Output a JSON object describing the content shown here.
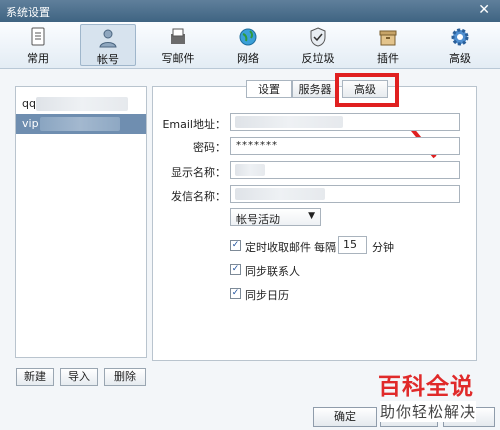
{
  "window": {
    "title": "系统设置",
    "close_glyph": "✕"
  },
  "toolbar": {
    "items": [
      {
        "label": "常用",
        "icon": "document-icon"
      },
      {
        "label": "帐号",
        "icon": "user-icon",
        "active": true
      },
      {
        "label": "写邮件",
        "icon": "compose-icon"
      },
      {
        "label": "网络",
        "icon": "globe-icon"
      },
      {
        "label": "反垃圾",
        "icon": "shield-icon"
      },
      {
        "label": "插件",
        "icon": "box-icon"
      },
      {
        "label": "高级",
        "icon": "gear-icon"
      }
    ]
  },
  "accounts": {
    "items": [
      {
        "label": "qq"
      },
      {
        "label": "vip",
        "selected": true
      }
    ],
    "buttons": {
      "new": "新建",
      "import": "导入",
      "delete": "删除"
    }
  },
  "tabs": {
    "settings": "设置",
    "server": "服务器",
    "advanced": "高级"
  },
  "form": {
    "email_label": "Email地址：",
    "password_label": "密码：",
    "password_value": "*******",
    "display_name_label": "显示名称：",
    "sender_name_label": "发信名称：",
    "account_status": "帐号活动",
    "auto_fetch_label": "定时收取邮件",
    "interval_prefix": "每隔",
    "interval_value": "15",
    "interval_unit": "分钟",
    "sync_contacts": "同步联系人",
    "sync_calendar": "同步日历"
  },
  "footer": {
    "ok": "确定",
    "cancel_partial": "取消"
  },
  "watermark": {
    "big": "百科全说",
    "small": "助你轻松解决"
  },
  "colors": {
    "highlight": "#e02020",
    "selection": "#6f8eb0"
  }
}
